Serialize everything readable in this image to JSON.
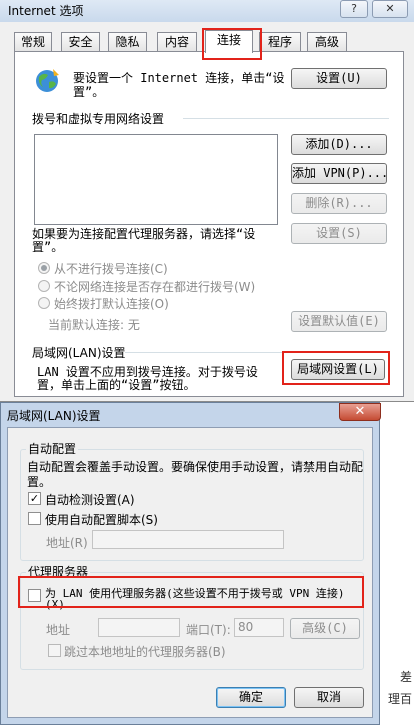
{
  "window": {
    "title": "Internet 选项",
    "help_btn": "?",
    "close_btn": "✕"
  },
  "tabs": [
    {
      "label": "常规"
    },
    {
      "label": "安全"
    },
    {
      "label": "隐私"
    },
    {
      "label": "内容"
    },
    {
      "label": "连接"
    },
    {
      "label": "程序"
    },
    {
      "label": "高级"
    }
  ],
  "connections": {
    "setup_text_1": "要设置一个 Internet 连接，单击“设",
    "setup_text_2": "置”。",
    "setup_button": "设置(U)",
    "dialup_heading": "拨号和虚拟专用网络设置",
    "add_button": "添加(D)...",
    "add_vpn_button": "添加 VPN(P)...",
    "delete_button": "删除(R)...",
    "proxy_text_1": "如果要为连接配置代理服务器，请选择“设",
    "proxy_text_2": "置”。",
    "settings_button": "设置(S)",
    "radio_never": "从不进行拨号连接(C)",
    "radio_no_network": "不论网络连接是否存在都进行拨号(W)",
    "radio_always": "始终拨打默认连接(O)",
    "current_default": "当前默认连接: 无",
    "set_default_button": "设置默认值(E)",
    "lan_heading": "局域网(LAN)设置",
    "lan_text_1": "LAN 设置不应用到拨号连接。对于拨号设",
    "lan_text_2": "置，单击上面的“设置”按钮。",
    "lan_button": "局域网设置(L)"
  },
  "lan_dialog": {
    "title": "局域网(LAN)设置",
    "close": "✕",
    "auto_config_group": "自动配置",
    "auto_config_text_1": "自动配置会覆盖手动设置。要确保使用手动设置，请禁用自动配",
    "auto_config_text_2": "置。",
    "auto_detect_label": "自动检测设置(A)",
    "auto_detect_checked": true,
    "auto_script_label": "使用自动配置脚本(S)",
    "auto_script_checked": false,
    "address_label": "地址(R)",
    "proxy_group": "代理服务器",
    "use_proxy_label_1": "为 LAN 使用代理服务器(这些设置不用于拨号或 VPN 连接)",
    "use_proxy_label_2": "(X)",
    "use_proxy_checked": false,
    "proxy_address_label": "地址",
    "port_label": "端口(T):",
    "port_value": "80",
    "advanced_button": "高级(C)",
    "bypass_label": "跳过本地地址的代理服务器(B)",
    "ok_button": "确定",
    "cancel_button": "取消"
  },
  "background_text": {
    "right_1": "差",
    "right_2": "理百"
  }
}
